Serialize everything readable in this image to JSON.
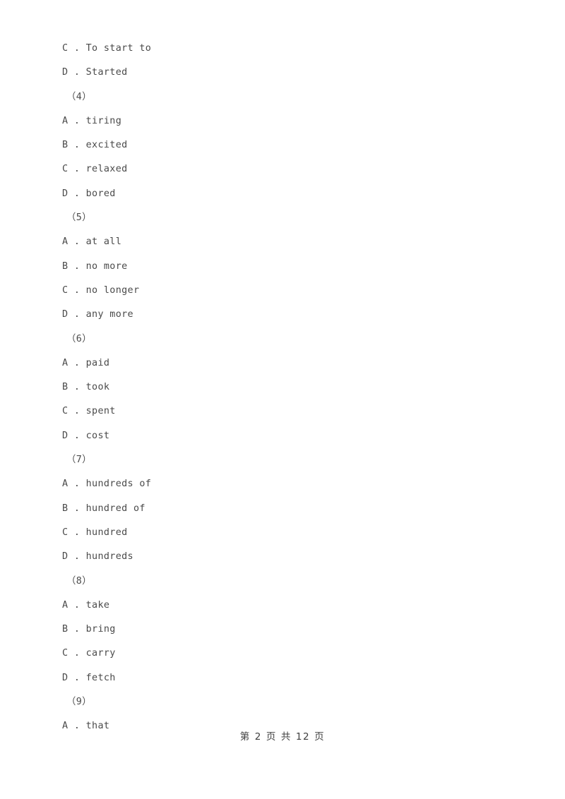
{
  "document": {
    "page_background": "#ffffff",
    "text_color": "#4a4a4a",
    "lines": [
      {
        "kind": "option",
        "text": "C . To start to"
      },
      {
        "kind": "option",
        "text": "D . Started"
      },
      {
        "kind": "qnum",
        "text": "（4）"
      },
      {
        "kind": "option",
        "text": "A . tiring"
      },
      {
        "kind": "option",
        "text": "B . excited"
      },
      {
        "kind": "option",
        "text": "C . relaxed"
      },
      {
        "kind": "option",
        "text": "D . bored"
      },
      {
        "kind": "qnum",
        "text": "（5）"
      },
      {
        "kind": "option",
        "text": "A . at all"
      },
      {
        "kind": "option",
        "text": "B . no more"
      },
      {
        "kind": "option",
        "text": "C . no longer"
      },
      {
        "kind": "option",
        "text": "D . any more"
      },
      {
        "kind": "qnum",
        "text": "（6）"
      },
      {
        "kind": "option",
        "text": "A . paid"
      },
      {
        "kind": "option",
        "text": "B . took"
      },
      {
        "kind": "option",
        "text": "C . spent"
      },
      {
        "kind": "option",
        "text": "D . cost"
      },
      {
        "kind": "qnum",
        "text": "（7）"
      },
      {
        "kind": "option",
        "text": "A . hundreds of"
      },
      {
        "kind": "option",
        "text": "B . hundred of"
      },
      {
        "kind": "option",
        "text": "C . hundred"
      },
      {
        "kind": "option",
        "text": "D . hundreds"
      },
      {
        "kind": "qnum",
        "text": "（8）"
      },
      {
        "kind": "option",
        "text": "A . take"
      },
      {
        "kind": "option",
        "text": "B . bring"
      },
      {
        "kind": "option",
        "text": "C . carry"
      },
      {
        "kind": "option",
        "text": "D . fetch"
      },
      {
        "kind": "qnum",
        "text": "（9）"
      },
      {
        "kind": "option",
        "text": "A . that"
      }
    ]
  },
  "footer": {
    "page_label": "第 2 页 共 12 页",
    "current_page": "2",
    "total_pages": "12"
  }
}
